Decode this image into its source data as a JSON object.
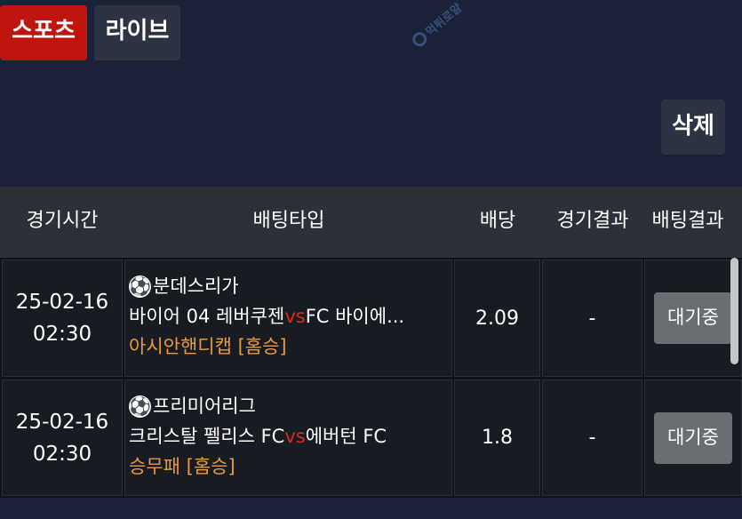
{
  "tabs": {
    "sports": "스포츠",
    "live": "라이브"
  },
  "delete_label": "삭제",
  "watermark_text": "먹튀로얄",
  "table": {
    "headers": {
      "time": "경기시간",
      "type": "배팅타입",
      "odds": "배당",
      "result": "경기결과",
      "bet_result": "배팅결과"
    },
    "rows": [
      {
        "date": "25-02-16",
        "time": "02:30",
        "league": "분데스리가",
        "home": "바이어 04 레버쿠젠",
        "vs": "vs",
        "away": "FC 바이에...",
        "market": "아시안핸디캡 [홈승]",
        "odds": "2.09",
        "result": "-",
        "status": "대기중"
      },
      {
        "date": "25-02-16",
        "time": "02:30",
        "league": "프리미어리그",
        "home": "크리스탈 펠리스 FC",
        "vs": "vs",
        "away": "에버턴 FC",
        "market": "승무패 [홈승]",
        "odds": "1.8",
        "result": "-",
        "status": "대기중"
      }
    ]
  },
  "colors": {
    "background": "#1b2238",
    "sports_tab": "#c0150f",
    "vs_text": "#d62a1e",
    "market_text": "#e89a3c",
    "status_button": "#6a6d72"
  },
  "icons": {
    "sport": "soccer-ball-icon",
    "watermark": "watermark-logo-icon"
  }
}
